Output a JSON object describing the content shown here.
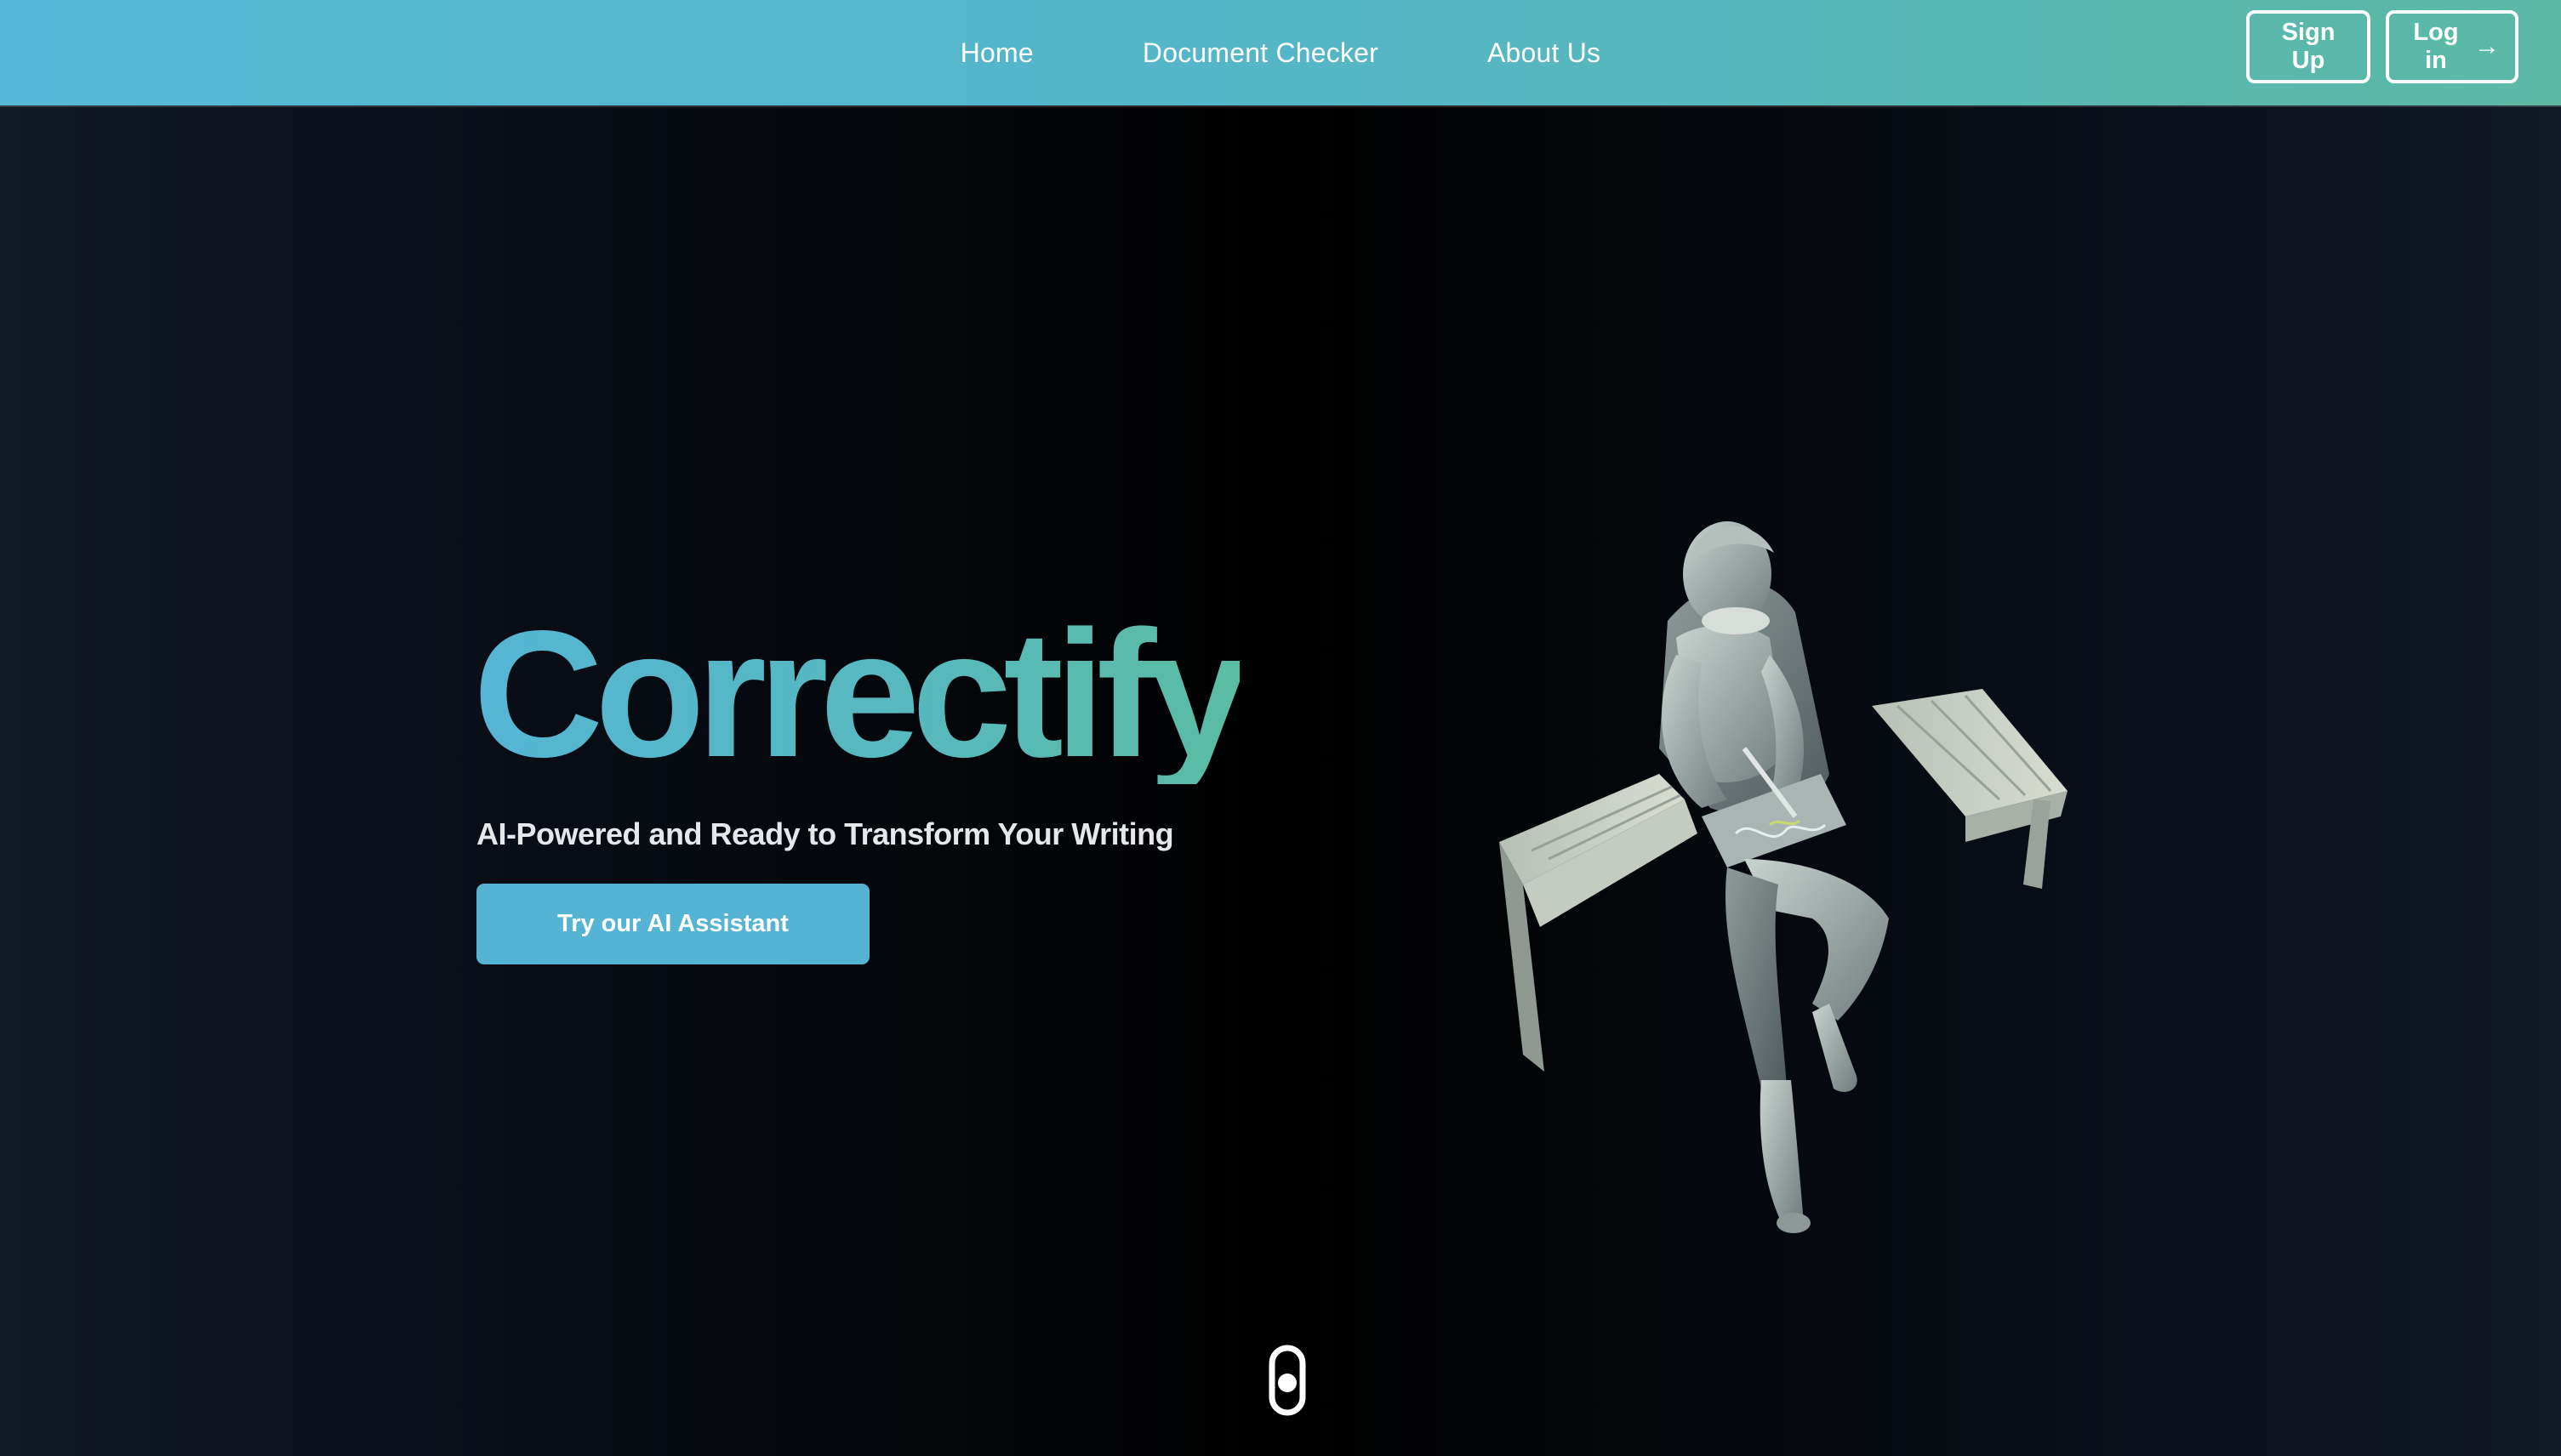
{
  "nav": {
    "links": [
      {
        "label": "Home"
      },
      {
        "label": "Document Checker"
      },
      {
        "label": "About Us"
      }
    ],
    "signup_label": "Sign Up",
    "login_label": "Log in",
    "login_icon": "arrow-right-icon",
    "gradient": [
      "#55b8d6",
      "#5bb9a4"
    ]
  },
  "hero": {
    "title": "Correctify",
    "tagline": "AI-Powered and Ready to Transform Your Writing",
    "cta_label": "Try our AI Assistant",
    "accent_color": "#55b4d3",
    "image_subject": "statue of a seated writer on a bench"
  },
  "scroll_indicator": {
    "icon": "scroll-mouse-icon"
  }
}
